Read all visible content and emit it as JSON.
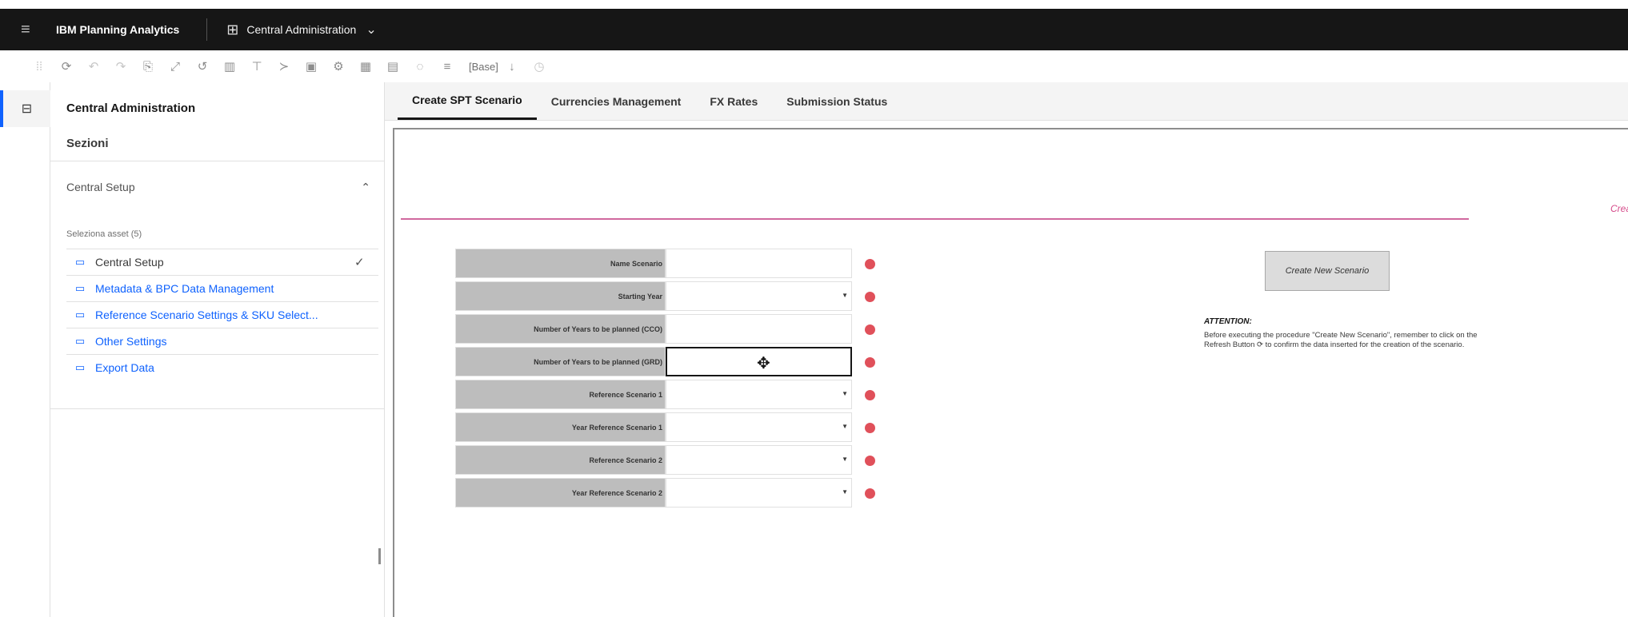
{
  "topbar": {
    "brand": "IBM Planning Analytics",
    "app_name": "Central Administration"
  },
  "toolbar": {
    "base_label": "[Base]"
  },
  "panel": {
    "title": "Central Administration",
    "subtitle": "Sezioni",
    "accordion_label": "Central Setup",
    "asset_label": "Seleziona asset (5)",
    "assets": [
      {
        "label": "Central Setup",
        "selected": true
      },
      {
        "label": "Metadata & BPC Data Management",
        "selected": false
      },
      {
        "label": "Reference Scenario Settings & SKU Select...",
        "selected": false
      },
      {
        "label": "Other Settings",
        "selected": false
      },
      {
        "label": "Export Data",
        "selected": false
      }
    ]
  },
  "tabs": [
    {
      "label": "Create SPT Scenario",
      "active": true
    },
    {
      "label": "Currencies Management",
      "active": false
    },
    {
      "label": "FX Rates",
      "active": false
    },
    {
      "label": "Submission Status",
      "active": false
    }
  ],
  "content": {
    "section_caption": "Create New Scenario",
    "form": [
      {
        "label": "Name Scenario",
        "dropdown": false
      },
      {
        "label": "Starting Year",
        "dropdown": true
      },
      {
        "label": "Number of Years to be planned (CCO)",
        "dropdown": false
      },
      {
        "label": "Number of Years to be planned (GRD)",
        "dropdown": false
      },
      {
        "label": "Reference Scenario 1",
        "dropdown": true
      },
      {
        "label": "Year Reference Scenario 1",
        "dropdown": true
      },
      {
        "label": "Reference Scenario 2",
        "dropdown": true
      },
      {
        "label": "Year Reference Scenario 2",
        "dropdown": true
      }
    ],
    "create_button": "Create New Scenario",
    "attention_title": "ATTENTION:",
    "attention_text": "Before executing the procedure \"Create New Scenario\", remember to click on the Refresh Button ⟳ to confirm the data inserted for the creation of the scenario."
  },
  "colors": {
    "topbar": "#161616",
    "accent": "#0f62fe",
    "pink_line": "#d0689e",
    "status_dot": "#e0505a"
  }
}
